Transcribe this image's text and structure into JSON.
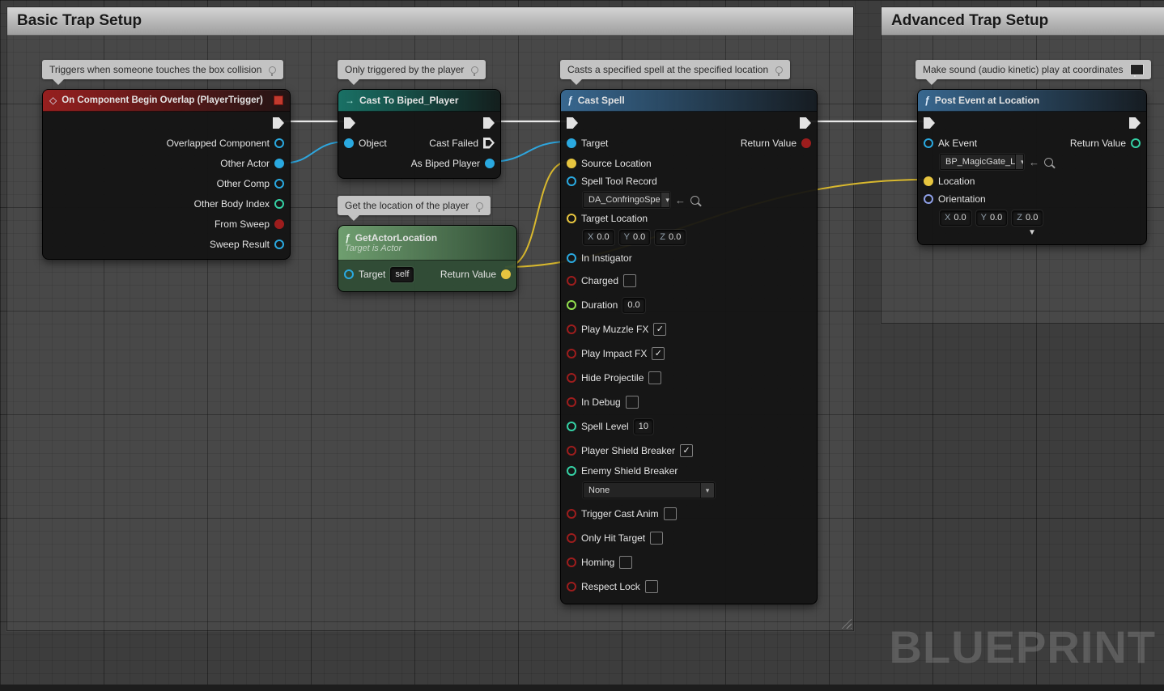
{
  "comments": {
    "basic": {
      "title": "Basic Trap Setup"
    },
    "advanced": {
      "title": "Advanced Trap Setup"
    }
  },
  "watermark": "BLUEPRINT",
  "axis": {
    "x": "X",
    "y": "Y",
    "z": "Z"
  },
  "icons": {
    "function": "ƒ",
    "event": "◇",
    "cast_arrow": "→",
    "dropdown_arrow": "▾",
    "collapse": "▼",
    "use_selected_asset": "←"
  },
  "colors": {
    "exec_pin": "#e2e2e2",
    "object_pin": "#2aa9e0",
    "vector_pin": "#e7c53f",
    "bool_pin": "#9d1d1d",
    "float_pin": "#93e04e",
    "int_pin": "#35d1a5",
    "rotator_pin": "#8fa0e8",
    "wire_exec": "#e9e9e9",
    "wire_object": "#2ea6de",
    "wire_vector": "#d8b82e"
  },
  "nodes": {
    "begin_overlap": {
      "bubble": "Triggers when someone touches the box collision",
      "title": "On Component Begin Overlap (PlayerTrigger)",
      "pins": {
        "overlapped_component": "Overlapped Component",
        "other_actor": "Other Actor",
        "other_comp": "Other Comp",
        "other_body_index": "Other Body Index",
        "from_sweep": "From Sweep",
        "sweep_result": "Sweep Result"
      }
    },
    "cast_to_player": {
      "bubble": "Only triggered by the player",
      "title": "Cast To Biped_Player",
      "pins": {
        "object": "Object",
        "cast_failed": "Cast Failed",
        "as_biped_player": "As Biped Player"
      }
    },
    "get_actor_location": {
      "bubble": "Get the location of the player",
      "title": "GetActorLocation",
      "subtitle": "Target is Actor",
      "pins": {
        "target": "Target",
        "target_value": "self",
        "return_value": "Return Value"
      }
    },
    "cast_spell": {
      "bubble": "Casts a specified spell at the specified location",
      "title": "Cast Spell",
      "pins": {
        "target": "Target",
        "source_location": "Source Location",
        "spell_tool_record": "Spell Tool Record",
        "spell_tool_record_value": "DA_ConfringoSpe",
        "target_location": "Target Location",
        "target_location_x": "0.0",
        "target_location_y": "0.0",
        "target_location_z": "0.0",
        "in_instigator": "In Instigator",
        "charged": "Charged",
        "duration": "Duration",
        "duration_value": "0.0",
        "play_muzzle_fx": "Play Muzzle FX",
        "play_impact_fx": "Play Impact FX",
        "hide_projectile": "Hide Projectile",
        "in_debug": "In Debug",
        "spell_level": "Spell Level",
        "spell_level_value": "10",
        "player_shield_breaker": "Player Shield Breaker",
        "enemy_shield_breaker": "Enemy Shield Breaker",
        "enemy_shield_breaker_value": "None",
        "trigger_cast_anim": "Trigger Cast Anim",
        "only_hit_target": "Only Hit Target",
        "homing": "Homing",
        "respect_lock": "Respect Lock",
        "return_value": "Return Value"
      },
      "checkboxes": {
        "charged": false,
        "play_muzzle_fx": true,
        "play_impact_fx": true,
        "hide_projectile": false,
        "in_debug": false,
        "player_shield_breaker": true,
        "trigger_cast_anim": false,
        "only_hit_target": false,
        "homing": false,
        "respect_lock": false
      }
    },
    "post_event": {
      "bubble": "Make sound (audio kinetic) play at coordinates",
      "title": "Post Event at Location",
      "pins": {
        "ak_event": "Ak Event",
        "ak_event_value": "BP_MagicGate_L",
        "location": "Location",
        "orientation": "Orientation",
        "orientation_x": "0.0",
        "orientation_y": "0.0",
        "orientation_z": "0.0",
        "return_value": "Return Value"
      }
    }
  }
}
